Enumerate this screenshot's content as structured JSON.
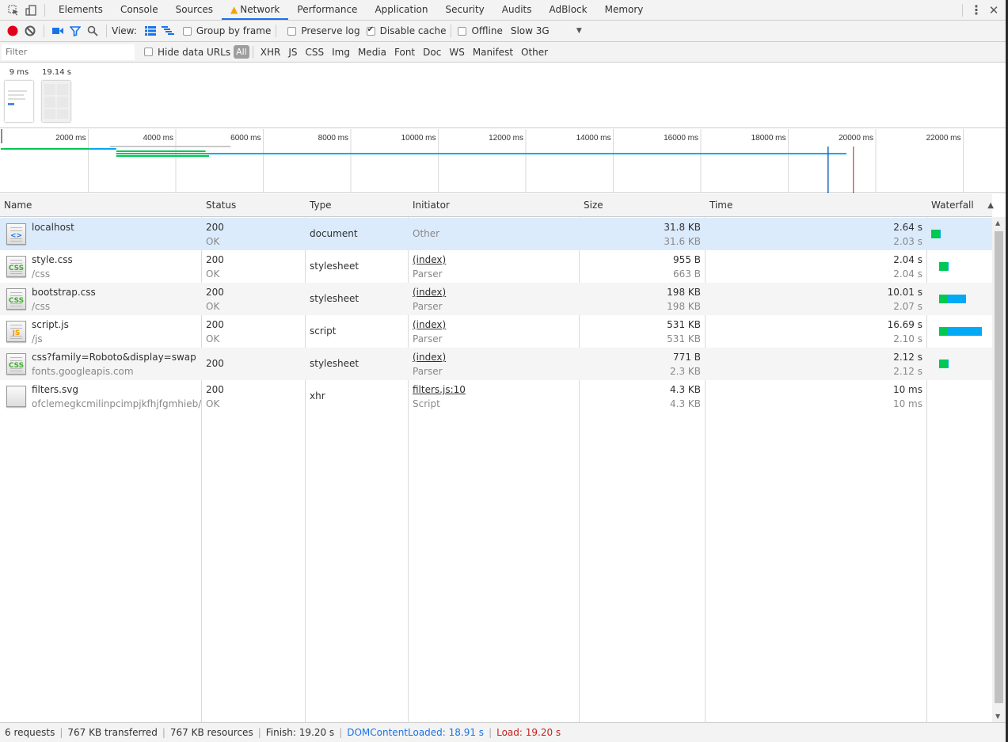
{
  "devtools_tabs": [
    {
      "label": "Elements",
      "active": false
    },
    {
      "label": "Console",
      "active": false
    },
    {
      "label": "Sources",
      "active": false
    },
    {
      "label": "Network",
      "active": true,
      "warning": true
    },
    {
      "label": "Performance",
      "active": false
    },
    {
      "label": "Application",
      "active": false
    },
    {
      "label": "Security",
      "active": false
    },
    {
      "label": "Audits",
      "active": false
    },
    {
      "label": "AdBlock",
      "active": false
    },
    {
      "label": "Memory",
      "active": false
    }
  ],
  "toolbar": {
    "view_label": "View:",
    "group_by_frame": {
      "label": "Group by frame",
      "checked": false
    },
    "preserve_log": {
      "label": "Preserve log",
      "checked": false
    },
    "disable_cache": {
      "label": "Disable cache",
      "checked": true
    },
    "offline": {
      "label": "Offline",
      "checked": false
    },
    "throttling": "Slow 3G",
    "record_color": "#e0001a"
  },
  "filterbar": {
    "placeholder": "Filter",
    "hide_data_urls": {
      "label": "Hide data URLs",
      "checked": false
    },
    "types": [
      "All",
      "XHR",
      "JS",
      "CSS",
      "Img",
      "Media",
      "Font",
      "Doc",
      "WS",
      "Manifest",
      "Other"
    ],
    "active_type": "All"
  },
  "screenshots": [
    {
      "time": "9 ms"
    },
    {
      "time": "19.14 s"
    }
  ],
  "overview": {
    "ticks": [
      "2000 ms",
      "4000 ms",
      "6000 ms",
      "8000 ms",
      "10000 ms",
      "12000 ms",
      "14000 ms",
      "16000 ms",
      "18000 ms",
      "20000 ms",
      "22000 ms"
    ],
    "max_ms": 23000,
    "dom_content_loaded_ms": 18910,
    "load_ms": 19200,
    "colors": {
      "waiting": "#00c853",
      "download": "#03a9f4",
      "queued": "#c8c8c8",
      "dcl": "#1565c0",
      "load": "#b71c1c"
    }
  },
  "columns": [
    "Name",
    "Status",
    "Type",
    "Initiator",
    "Size",
    "Time",
    "Waterfall"
  ],
  "requests": [
    {
      "name": "localhost",
      "path": "",
      "icon": "html-document-icon",
      "status": "200",
      "status_text": "OK",
      "type": "document",
      "initiator": "",
      "initiator_sub": "Other",
      "size": "31.8 KB",
      "resource_size": "31.6 KB",
      "time": "2.64 s",
      "latency": "2.03 s",
      "selected": true,
      "wf": {
        "start": 0.0,
        "wait": 2.03,
        "total": 2.64
      }
    },
    {
      "name": "style.css",
      "path": "/css",
      "icon": "css-file-icon",
      "status": "200",
      "status_text": "OK",
      "type": "stylesheet",
      "initiator": "(index)",
      "initiator_sub": "Parser",
      "size": "955 B",
      "resource_size": "663 B",
      "time": "2.04 s",
      "latency": "2.04 s",
      "wf": {
        "start": 2.64,
        "wait": 2.04,
        "total": 2.04
      }
    },
    {
      "name": "bootstrap.css",
      "path": "/css",
      "icon": "css-file-icon",
      "status": "200",
      "status_text": "OK",
      "type": "stylesheet",
      "initiator": "(index)",
      "initiator_sub": "Parser",
      "size": "198 KB",
      "resource_size": "198 KB",
      "time": "10.01 s",
      "latency": "2.07 s",
      "wf": {
        "start": 2.64,
        "wait": 2.07,
        "total": 10.01
      }
    },
    {
      "name": "script.js",
      "path": "/js",
      "icon": "js-file-icon",
      "status": "200",
      "status_text": "OK",
      "type": "script",
      "initiator": "(index)",
      "initiator_sub": "Parser",
      "size": "531 KB",
      "resource_size": "531 KB",
      "time": "16.69 s",
      "latency": "2.10 s",
      "wf": {
        "start": 2.64,
        "wait": 2.1,
        "total": 16.69
      }
    },
    {
      "name": "css?family=Roboto&display=swap",
      "path": "fonts.googleapis.com",
      "icon": "css-file-icon",
      "status": "200",
      "status_text": "",
      "type": "stylesheet",
      "initiator": "(index)",
      "initiator_sub": "Parser",
      "size": "771 B",
      "resource_size": "2.3 KB",
      "time": "2.12 s",
      "latency": "2.12 s",
      "wf": {
        "start": 2.64,
        "wait": 2.12,
        "total": 2.12
      }
    },
    {
      "name": "filters.svg",
      "path": "ofclemegkcmilinpcimpjkfhjfgmhieb/img",
      "icon": "generic-file-icon",
      "status": "200",
      "status_text": "OK",
      "type": "xhr",
      "initiator": "filters.js:10",
      "initiator_sub": "Script",
      "size": "4.3 KB",
      "resource_size": "4.3 KB",
      "time": "10 ms",
      "latency": "10 ms",
      "wf": null
    }
  ],
  "waterfall_max_s": 19.3,
  "status_bar": {
    "requests": "6 requests",
    "transferred": "767 KB transferred",
    "resources": "767 KB resources",
    "finish": "Finish: 19.20 s",
    "dom_content_loaded": "DOMContentLoaded: 18.91 s",
    "load": "Load: 19.20 s"
  }
}
